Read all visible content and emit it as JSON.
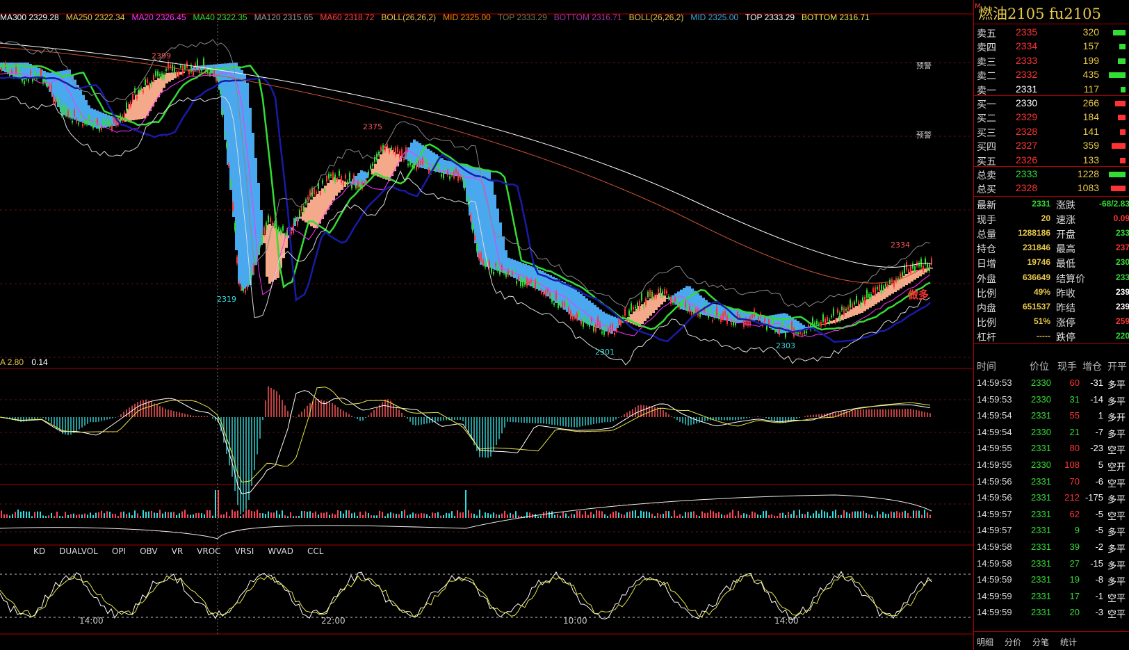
{
  "indicators": [
    {
      "text": "MA300 2329.28",
      "color": "#ffffff"
    },
    {
      "text": "MA250 2322.34",
      "color": "#e8c84a"
    },
    {
      "text": "MA20 2326.45",
      "color": "#ff33ff"
    },
    {
      "text": "MA40 2322.35",
      "color": "#33dd33"
    },
    {
      "text": "MA120 2315.65",
      "color": "#999999"
    },
    {
      "text": "MA60 2318.72",
      "color": "#ff4444"
    },
    {
      "text": "BOLL(26,26,2)",
      "color": "#e8c84a"
    },
    {
      "text": "MID 2325.00",
      "color": "#ff8800"
    },
    {
      "text": "TOP 2333.29",
      "color": "#777755"
    },
    {
      "text": "BOTTOM 2316.71",
      "color": "#aa33aa"
    },
    {
      "text": "BOLL(26,26,2)",
      "color": "#e8c84a"
    },
    {
      "text": "MID 2325.00",
      "color": "#33aadd"
    },
    {
      "text": "TOP 2333.29",
      "color": "#ffffff"
    },
    {
      "text": "BOTTOM 2316.71",
      "color": "#e8e84a"
    }
  ],
  "price_labels": {
    "high1": "2399",
    "high2": "2375",
    "low1": "2319",
    "low2": "2301",
    "low3": "2303",
    "last_high": "2334",
    "warn1": "预警",
    "warn2": "预警",
    "signal": "做多"
  },
  "macd_label": {
    "a": "A 2.80",
    "b": "0.14"
  },
  "sub_tabs": [
    "KD",
    "DUALVOL",
    "OPI",
    "OBV",
    "VR",
    "VROC",
    "VRSI",
    "WVAD",
    "CCL"
  ],
  "time_axis": [
    "14:00",
    "22:00",
    "10:00",
    "14:00"
  ],
  "side": {
    "title": "燃油2105  fu2105",
    "title_mark": "M",
    "asks": [
      {
        "label": "卖五",
        "price": "2335",
        "vol": "320",
        "frac": 0.75
      },
      {
        "label": "卖四",
        "price": "2334",
        "vol": "157",
        "frac": 0.37
      },
      {
        "label": "卖三",
        "price": "2333",
        "vol": "199",
        "frac": 0.47
      },
      {
        "label": "卖二",
        "price": "2332",
        "vol": "435",
        "frac": 1.0
      },
      {
        "label": "卖一",
        "price": "2331",
        "vol": "117",
        "frac": 0.28
      }
    ],
    "bids": [
      {
        "label": "买一",
        "price": "2330",
        "vol": "266",
        "frac": 0.63
      },
      {
        "label": "买二",
        "price": "2329",
        "vol": "184",
        "frac": 0.44
      },
      {
        "label": "买三",
        "price": "2328",
        "vol": "141",
        "frac": 0.33
      },
      {
        "label": "买四",
        "price": "2327",
        "vol": "359",
        "frac": 0.85
      },
      {
        "label": "买五",
        "price": "2326",
        "vol": "133",
        "frac": 0.32
      }
    ],
    "totals": [
      {
        "label": "总卖",
        "price": "2333",
        "vol": "1228",
        "frac": 1.0
      },
      {
        "label": "总买",
        "price": "2328",
        "vol": "1083",
        "frac": 0.88
      }
    ],
    "stats": [
      {
        "l1": "最新",
        "v1": "2331",
        "l2": "涨跌",
        "v2": "-68/2.83"
      },
      {
        "l1": "现手",
        "v1": "20",
        "l2": "速涨",
        "v2": "0.09"
      },
      {
        "l1": "总量",
        "v1": "1288186",
        "l2": "开盘",
        "v2": "233"
      },
      {
        "l1": "持仓",
        "v1": "231846",
        "l2": "最高",
        "v2": "237"
      },
      {
        "l1": "日增",
        "v1": "19746",
        "l2": "最低",
        "v2": "230"
      },
      {
        "l1": "外盘",
        "v1": "636649",
        "l2": "结算价",
        "v2": "233"
      },
      {
        "l1": "比例",
        "v1": "49%",
        "l2": "昨收",
        "v2": "239"
      },
      {
        "l1": "内盘",
        "v1": "651537",
        "l2": "昨结",
        "v2": "239"
      },
      {
        "l1": "比例",
        "v1": "51%",
        "l2": "涨停",
        "v2": "259"
      },
      {
        "l1": "杠杆",
        "v1": "-----",
        "l2": "跌停",
        "v2": "220"
      }
    ],
    "trade_header": {
      "time": "时间",
      "price": "价位",
      "hand": "现手",
      "oi": "增仓",
      "type": "开平"
    },
    "trades": [
      {
        "time": "14:59:53",
        "price": "2330",
        "hand": "60",
        "oi": "-31",
        "type": "多平"
      },
      {
        "time": "14:59:53",
        "price": "2330",
        "hand": "31",
        "oi": "-14",
        "type": "多平"
      },
      {
        "time": "14:59:54",
        "price": "2331",
        "hand": "55",
        "oi": "1",
        "type": "多开"
      },
      {
        "time": "14:59:54",
        "price": "2330",
        "hand": "21",
        "oi": "-7",
        "type": "多平"
      },
      {
        "time": "14:59:55",
        "price": "2331",
        "hand": "80",
        "oi": "-23",
        "type": "空平"
      },
      {
        "time": "14:59:55",
        "price": "2330",
        "hand": "108",
        "oi": "5",
        "type": "空开"
      },
      {
        "time": "14:59:56",
        "price": "2331",
        "hand": "70",
        "oi": "-6",
        "type": "空平"
      },
      {
        "time": "14:59:56",
        "price": "2331",
        "hand": "212",
        "oi": "-175",
        "type": "多平"
      },
      {
        "time": "14:59:57",
        "price": "2331",
        "hand": "62",
        "oi": "-5",
        "type": "空平"
      },
      {
        "time": "14:59:57",
        "price": "2331",
        "hand": "9",
        "oi": "-5",
        "type": "多平"
      },
      {
        "time": "14:59:58",
        "price": "2331",
        "hand": "39",
        "oi": "-2",
        "type": "多平"
      },
      {
        "time": "14:59:58",
        "price": "2331",
        "hand": "27",
        "oi": "-15",
        "type": "多平"
      },
      {
        "time": "14:59:59",
        "price": "2331",
        "hand": "19",
        "oi": "-8",
        "type": "多平"
      },
      {
        "time": "14:59:59",
        "price": "2331",
        "hand": "17",
        "oi": "-1",
        "type": "空平"
      },
      {
        "time": "14:59:59",
        "price": "2331",
        "hand": "20",
        "oi": "-3",
        "type": "空平"
      }
    ],
    "tabs": [
      "明细",
      "分价",
      "分笔",
      "统计"
    ]
  },
  "colors": {
    "up": "#ff3333",
    "down": "#33dd33",
    "neutral": "#ffffff",
    "yellow": "#e8c84a",
    "cyan": "#33dddd",
    "panel_border": "#aa0000"
  }
}
